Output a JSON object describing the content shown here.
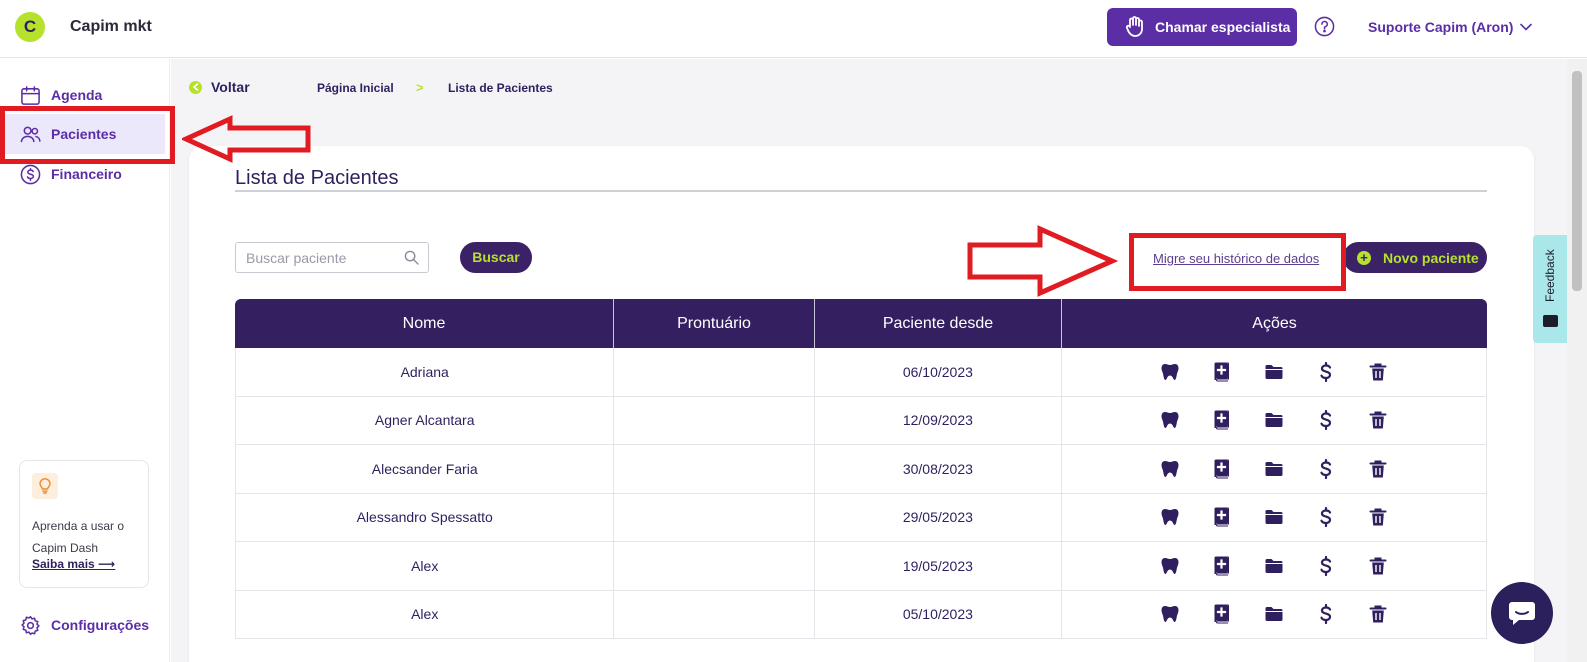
{
  "topbar": {
    "logo_letter": "C",
    "brand": "Capim mkt",
    "call_button": "Chamar especialista",
    "user": "Suporte Capim (Aron)"
  },
  "sidebar": {
    "items": [
      {
        "label": "Agenda",
        "icon": "calendar-icon"
      },
      {
        "label": "Pacientes",
        "icon": "users-icon",
        "active": true
      },
      {
        "label": "Financeiro",
        "icon": "dollar-circle-icon"
      }
    ],
    "tip": {
      "text": "Aprenda a usar o Capim Dash",
      "link": "Saiba mais ⟶"
    },
    "settings": "Configurações"
  },
  "breadcrumb": {
    "back": "Voltar",
    "home": "Página Inicial",
    "separator": ">",
    "current": "Lista de Pacientes"
  },
  "patients": {
    "title": "Lista de Pacientes",
    "search_placeholder": "Buscar paciente",
    "search_button": "Buscar",
    "migrate_link": "Migre seu histórico de dados",
    "new_button": "Novo paciente",
    "columns": [
      "Nome",
      "Prontuário",
      "Paciente desde",
      "Ações"
    ],
    "rows": [
      {
        "name": "Adriana",
        "record": "",
        "since": "06/10/2023"
      },
      {
        "name": "Agner Alcantara",
        "record": "",
        "since": "12/09/2023"
      },
      {
        "name": "Alecsander Faria",
        "record": "",
        "since": "30/08/2023"
      },
      {
        "name": "Alessandro Spessatto",
        "record": "",
        "since": "29/05/2023"
      },
      {
        "name": "Alex",
        "record": "",
        "since": "19/05/2023"
      },
      {
        "name": "Alex",
        "record": "",
        "since": "05/10/2023"
      }
    ],
    "actions": [
      "tooth-icon",
      "medical-book-icon",
      "folder-icon",
      "dollar-icon",
      "trash-icon"
    ]
  },
  "feedback": "Feedback",
  "colors": {
    "accent": "#5b2ea6",
    "dark": "#342060",
    "lime": "#b6e12d",
    "annotation": "#e11b22"
  }
}
